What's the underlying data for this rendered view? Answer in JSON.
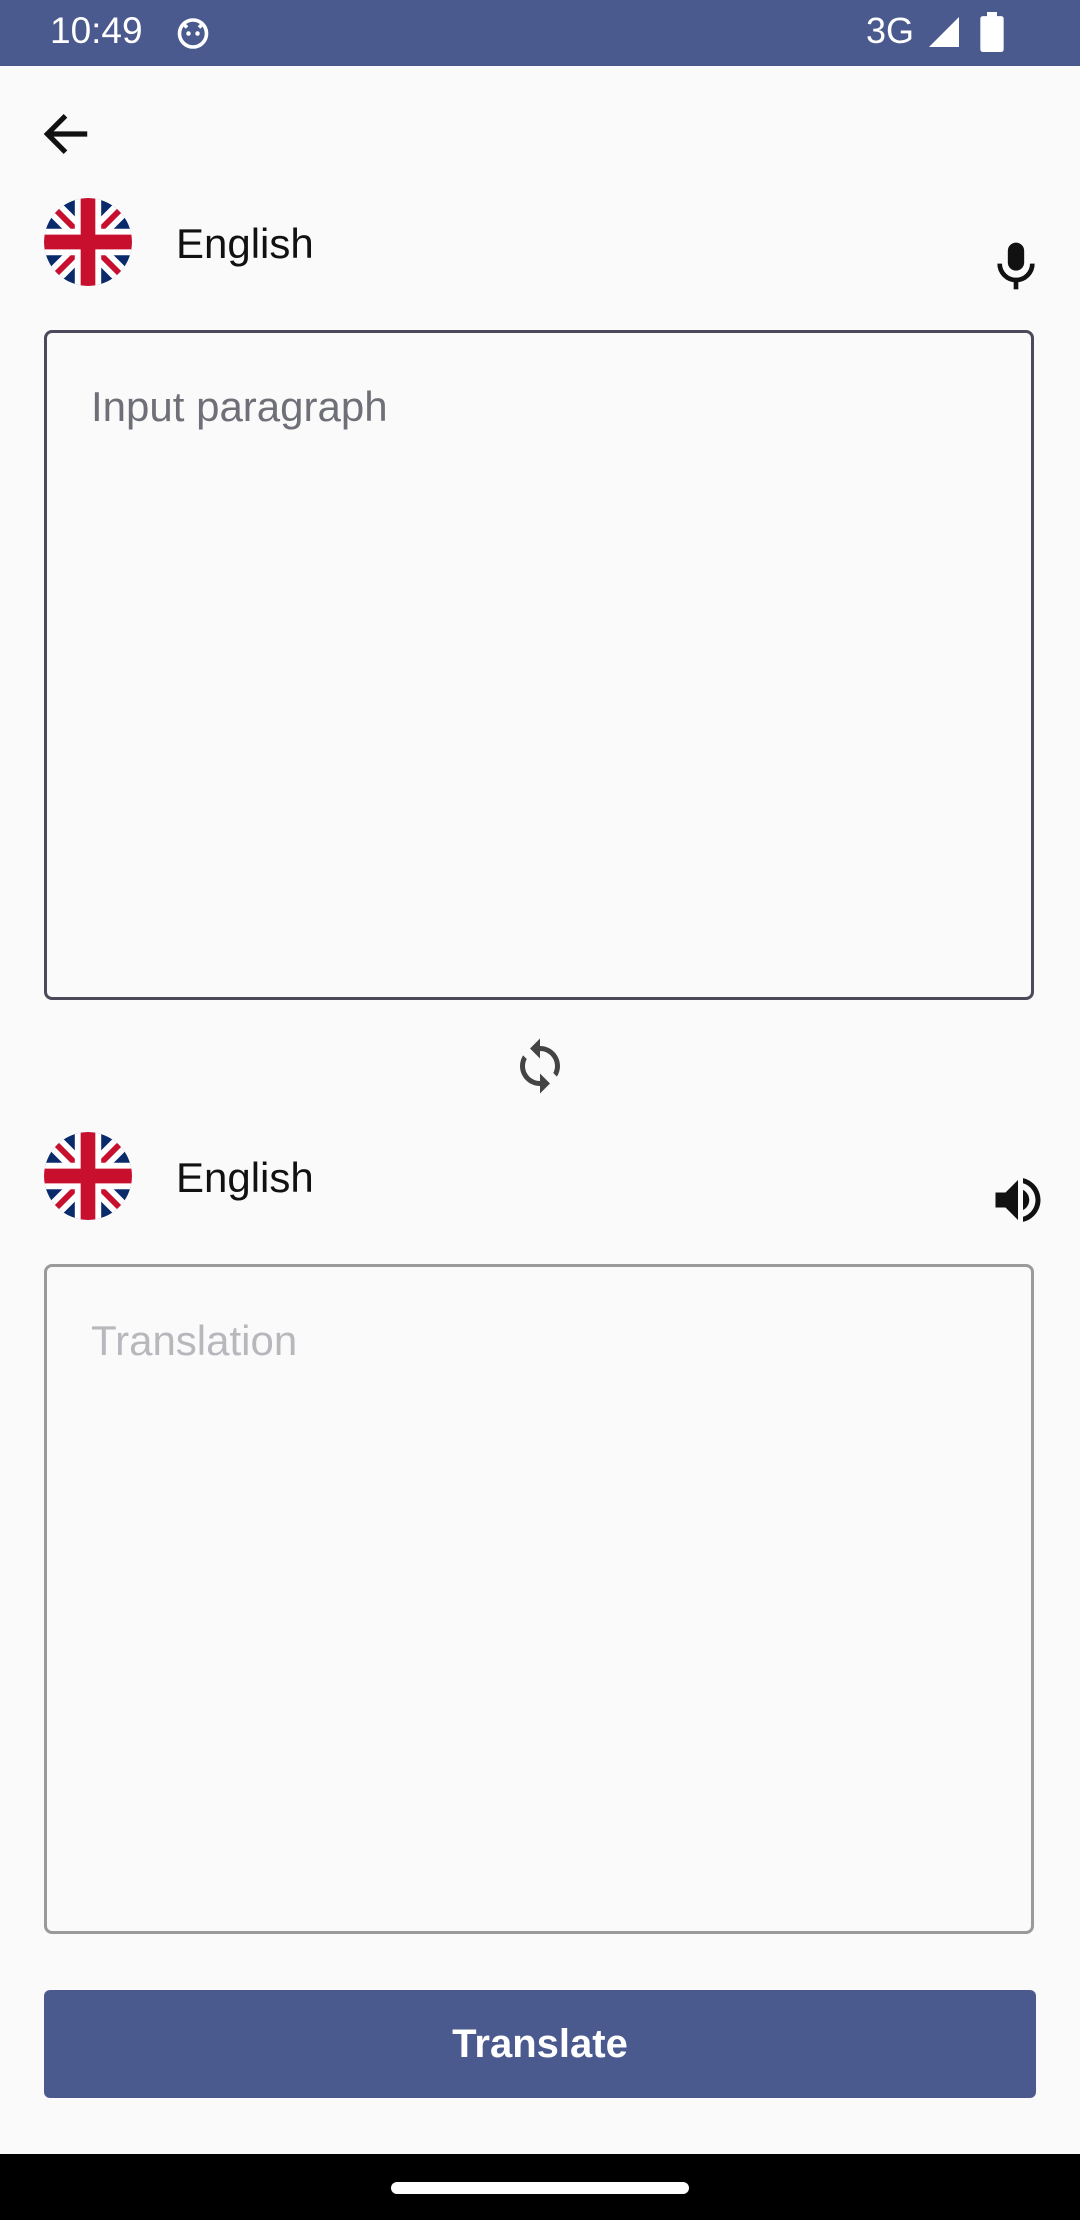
{
  "status_bar": {
    "time": "10:49",
    "network": "3G",
    "background_color": "#4A5A8F"
  },
  "source": {
    "language": "English",
    "flag": "uk-flag",
    "placeholder": "Input paragraph",
    "action_icon": "mic-icon"
  },
  "target": {
    "language": "English",
    "flag": "uk-flag",
    "placeholder": "Translation",
    "action_icon": "speaker-icon"
  },
  "swap_icon": "swap-icon",
  "translate_button": {
    "label": "Translate",
    "color": "#4A5A8F"
  }
}
